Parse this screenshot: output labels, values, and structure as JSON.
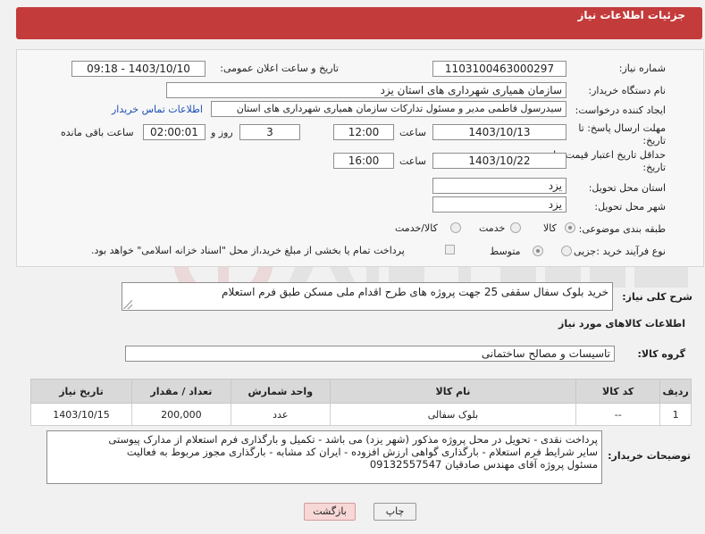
{
  "header": {
    "title": "جزئیات اطلاعات نیاز"
  },
  "fields": {
    "need_number_label": "شماره نیاز:",
    "need_number": "1103100463000297",
    "announce_label": "تاریخ و ساعت اعلان عمومی:",
    "announce_value": "1403/10/10 - 09:18",
    "buyer_org_label": "نام دستگاه خریدار:",
    "buyer_org": "سازمان همیاری شهرداری های استان یزد",
    "requester_label": "ایجاد کننده درخواست:",
    "requester": "سیدرسول فاطمی مدیر و مسئول تدارکات سازمان همیاری شهرداری های استان",
    "contact_link": "اطلاعات تماس خریدار",
    "deadline_label_1": "مهلت ارسال پاسخ: تا",
    "deadline_label_2": "تاریخ:",
    "deadline_date": "1403/10/13",
    "time_label": "ساعت",
    "deadline_time": "12:00",
    "days_value": "3",
    "days_label": "روز و",
    "remaining_value": "02:00:01",
    "remaining_label": "ساعت باقی مانده",
    "validity_label_1": "حداقل تاریخ اعتبار قیمت: تا",
    "validity_label_2": "تاریخ:",
    "validity_date": "1403/10/22",
    "validity_time": "16:00",
    "province_label": "استان محل تحویل:",
    "province": "یزد",
    "city_label": "شهر محل تحویل:",
    "city": "یزد",
    "category_label": "طبقه بندی موضوعی:",
    "category_options": [
      "کالا",
      "خدمت",
      "کالا/خدمت"
    ],
    "process_label": "نوع فرآیند خرید :",
    "process_options": [
      "جزیی",
      "متوسط"
    ],
    "payment_note": "پرداخت تمام یا بخشی از مبلغ خرید،از محل \"اسناد خزانه اسلامی\" خواهد بود."
  },
  "description": {
    "label": "شرح کلی نیاز:",
    "text": "خرید بلوک سفال سقفی 25 جهت پروژه های طرح اقدام ملی مسکن طبق فرم استعلام"
  },
  "goods": {
    "section_title": "اطلاعات کالاهای مورد نیاز",
    "group_label": "گروه کالا:",
    "group_value": "تاسیسات و مصالح ساختمانی",
    "columns": [
      "ردیف",
      "کد کالا",
      "نام کالا",
      "واحد شمارش",
      "تعداد / مقدار",
      "تاریخ نیاز"
    ],
    "rows": [
      [
        "1",
        "--",
        "بلوک سفالی",
        "عدد",
        "200,000",
        "1403/10/15"
      ]
    ]
  },
  "buyer_notes": {
    "label": "توضیحات خریدار:",
    "lines": [
      "پرداخت نقدی - تحویل در محل پروژه مذکور (شهر یزد) می باشد - تکمیل و بارگذاری فرم استعلام از مدارک پیوستی",
      "سایر شرایط فرم استعلام - بارگذاری گواهی ارزش افزوده - ایران کد مشابه - بارگذاری مجوز مربوط به فعالیت",
      "مسئول پروژه آقای مهندس صادقیان 09132557547"
    ]
  },
  "buttons": {
    "print": "چاپ",
    "back": "بازگشت"
  },
  "colors": {
    "header": "#c43b3b",
    "link": "#1a4fb5",
    "back_button": "#f8d7d7"
  }
}
